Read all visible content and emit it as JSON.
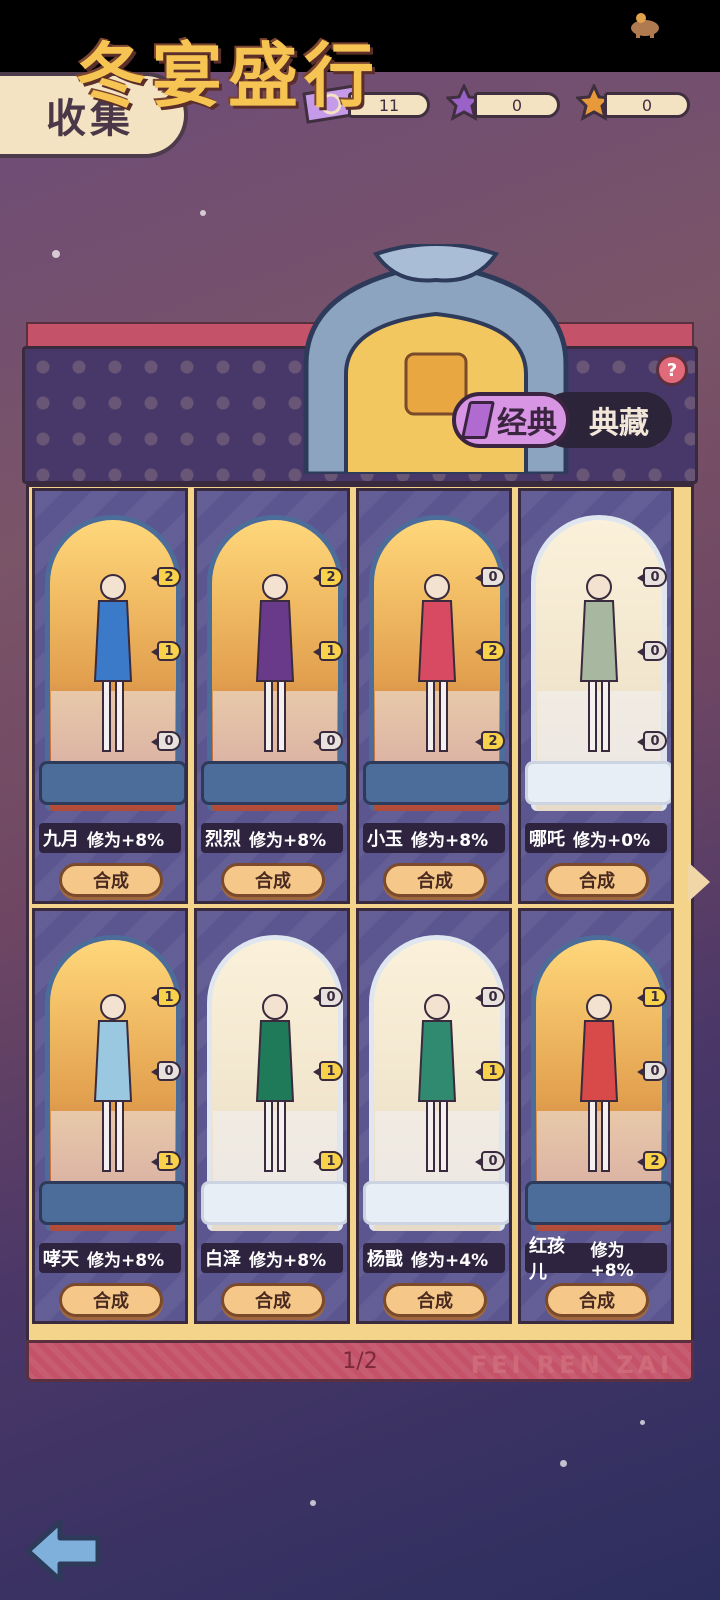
{
  "header": {
    "title": "收集"
  },
  "resources": [
    {
      "name": "ticket",
      "value": "11",
      "color": "#b98ce0"
    },
    {
      "name": "purple-star",
      "value": "0",
      "color": "#9a62c8"
    },
    {
      "name": "orange-star",
      "value": "0",
      "color": "#e89a3a"
    }
  ],
  "banner": {
    "title": "冬宴盛行",
    "tab_active": "经典",
    "tab_inactive": "典藏",
    "help": "?"
  },
  "cards": [
    {
      "name": "九月",
      "stat": "修为+8%",
      "badges": [
        "2",
        "1",
        "0"
      ],
      "unlocked": true,
      "outfit": "#3a7ac8",
      "button": "合成"
    },
    {
      "name": "烈烈",
      "stat": "修为+8%",
      "badges": [
        "2",
        "1",
        "0"
      ],
      "unlocked": true,
      "outfit": "#6a3a8a",
      "button": "合成"
    },
    {
      "name": "小玉",
      "stat": "修为+8%",
      "badges": [
        "0",
        "2",
        "2"
      ],
      "unlocked": true,
      "outfit": "#d84a62",
      "button": "合成"
    },
    {
      "name": "哪吒",
      "stat": "修为+0%",
      "badges": [
        "0",
        "0",
        "0"
      ],
      "unlocked": false,
      "outfit": "#a8b8a0",
      "button": "合成"
    },
    {
      "name": "哮天",
      "stat": "修为+8%",
      "badges": [
        "1",
        "0",
        "1"
      ],
      "unlocked": true,
      "outfit": "#9ac8e0",
      "button": "合成"
    },
    {
      "name": "白泽",
      "stat": "修为+8%",
      "badges": [
        "0",
        "1",
        "1"
      ],
      "unlocked": false,
      "outfit": "#1f7a5a",
      "button": "合成"
    },
    {
      "name": "杨戬",
      "stat": "修为+4%",
      "badges": [
        "0",
        "1",
        "0"
      ],
      "unlocked": false,
      "outfit": "#2f8a70",
      "button": "合成"
    },
    {
      "name": "红孩儿",
      "stat": "修为+8%",
      "badges": [
        "1",
        "0",
        "2"
      ],
      "unlocked": true,
      "outfit": "#d84a4a",
      "button": "合成"
    }
  ],
  "pager": {
    "text": "1/2"
  },
  "watermark": "FEI REN ZAI"
}
